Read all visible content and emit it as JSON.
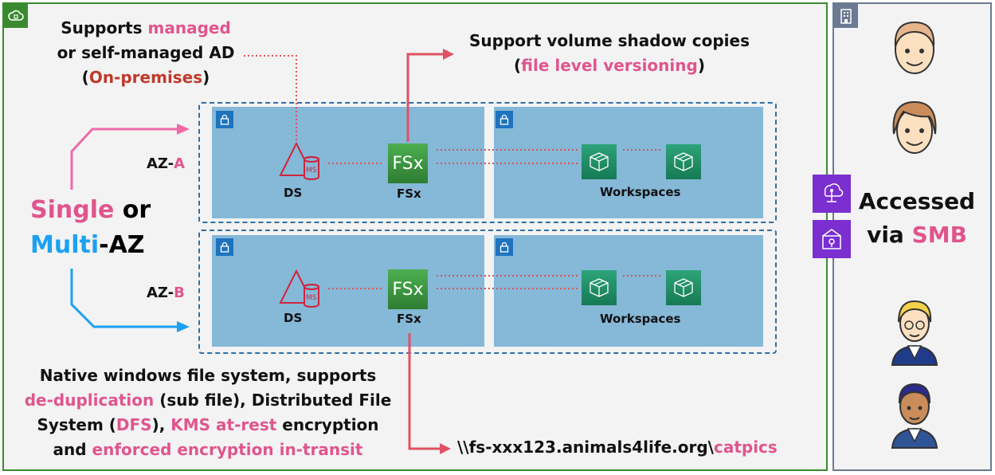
{
  "ad_note": {
    "line1_a": "Supports ",
    "line1_b": "managed",
    "line2": "or self-managed AD",
    "line3_a": "(",
    "line3_b": "On-premises",
    "line3_c": ")"
  },
  "shadow_note": {
    "line1": "Support volume shadow copies",
    "line2_a": "(",
    "line2_b": "file level versioning",
    "line2_c": ")"
  },
  "az_a": {
    "prefix": "AZ-",
    "letter": "A"
  },
  "az_b": {
    "prefix": "AZ-",
    "letter": "B"
  },
  "deployment": {
    "single": "Single",
    "or": " or",
    "multi": "Multi",
    "az": "-AZ"
  },
  "labels": {
    "ds": "DS",
    "ms": "MS",
    "fsx": "FSx",
    "fsx_icon": "FSx",
    "workspaces": "Workspaces"
  },
  "features": {
    "l1": "Native windows file system, supports",
    "l2_a": "de-duplication",
    "l2_b": " (sub file), Distributed File",
    "l3_a": "System (",
    "l3_b": "DFS",
    "l3_c": "), ",
    "l3_d": "KMS at-rest",
    "l3_e": " encryption",
    "l4_a": "and ",
    "l4_b": "enforced encryption in-transit"
  },
  "path": {
    "prefix": "\\\\fs-xxx123.animals4life.org\\",
    "share": "catpics"
  },
  "access": {
    "line1": "Accessed",
    "line2_a": "via ",
    "line2_b": "SMB"
  },
  "colors": {
    "aws_cloud_green": "#3a8a2f",
    "corporate_grey": "#6b7a92",
    "highlight_pink": "#e0558e",
    "highlight_red": "#c0392b",
    "highlight_blue": "#1da1f2",
    "subnet_blue": "#86b8d8",
    "fsx_green": "#3f9c3a",
    "workspaces_green": "#1f8a63",
    "purple_icon": "#7b2fd0"
  },
  "icons": [
    "cloud-icon",
    "building-icon",
    "lock-icon",
    "directory-service-icon",
    "fsx-icon",
    "workspaces-icon",
    "client-vpn-icon",
    "vpn-gateway-icon",
    "user-avatar"
  ]
}
